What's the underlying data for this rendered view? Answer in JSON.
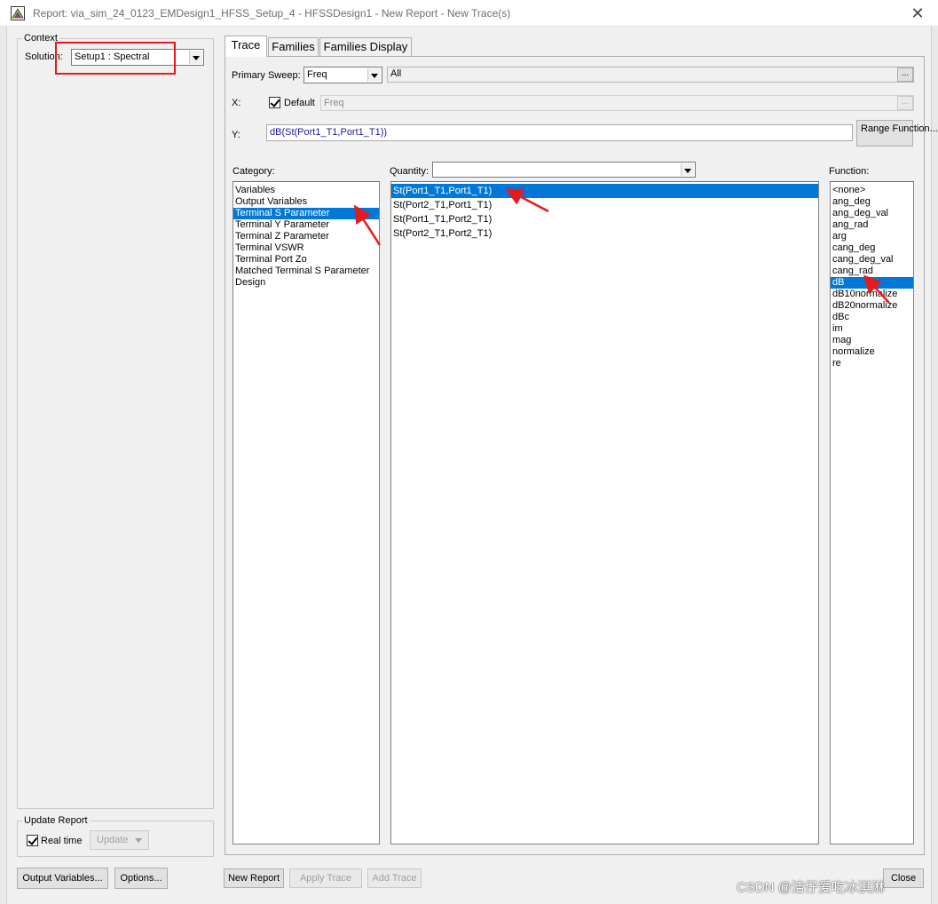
{
  "window": {
    "title": "Report: via_sim_24_0123_EMDesign1_HFSS_Setup_4 - HFSSDesign1 - New Report - New Trace(s)"
  },
  "context": {
    "label": "Context",
    "solution_label": "Solution:",
    "solution_value": "Setup1 : Spectral"
  },
  "update_report": {
    "label": "Update Report",
    "realtime_label": "Real time",
    "update_label": "Update"
  },
  "tabs": [
    "Trace",
    "Families",
    "Families Display"
  ],
  "primary_sweep": {
    "label": "Primary Sweep:",
    "value": "Freq",
    "range": "All",
    "ellipsis": "..."
  },
  "x_axis": {
    "label": "X:",
    "default_label": "Default",
    "value": "Freq",
    "ellipsis": "..."
  },
  "y_axis": {
    "label": "Y:",
    "value": "dB(St(Port1_T1,Port1_T1))",
    "range_function_label": "Range Function..."
  },
  "category": {
    "label": "Category:",
    "items": [
      "Variables",
      "Output Variables",
      "Terminal S Parameter",
      "Terminal Y Parameter",
      "Terminal Z Parameter",
      "Terminal VSWR",
      "Terminal Port Zo",
      "Matched Terminal S Parameter",
      "Design"
    ],
    "selected": "Terminal S Parameter"
  },
  "quantity": {
    "label": "Quantity:",
    "filter_value": "",
    "items": [
      "St(Port1_T1,Port1_T1)",
      "St(Port2_T1,Port1_T1)",
      "St(Port1_T1,Port2_T1)",
      "St(Port2_T1,Port2_T1)"
    ],
    "selected": "St(Port1_T1,Port1_T1)"
  },
  "function": {
    "label": "Function:",
    "items": [
      "<none>",
      "ang_deg",
      "ang_deg_val",
      "ang_rad",
      "arg",
      "cang_deg",
      "cang_deg_val",
      "cang_rad",
      "dB",
      "dB10normalize",
      "dB20normalize",
      "dBc",
      "im",
      "mag",
      "normalize",
      "re"
    ],
    "selected": "dB"
  },
  "buttons": {
    "output_variables": "Output Variables...",
    "options": "Options...",
    "new_report": "New Report",
    "apply_trace": "Apply Trace",
    "add_trace": "Add Trace",
    "close": "Close"
  },
  "watermark": "CSDN @洁仔爱吃冰淇淋",
  "colors": {
    "selection": "#0078d7",
    "annotation_red": "#e8191c",
    "y_expression_text": "#1a1aa6"
  }
}
